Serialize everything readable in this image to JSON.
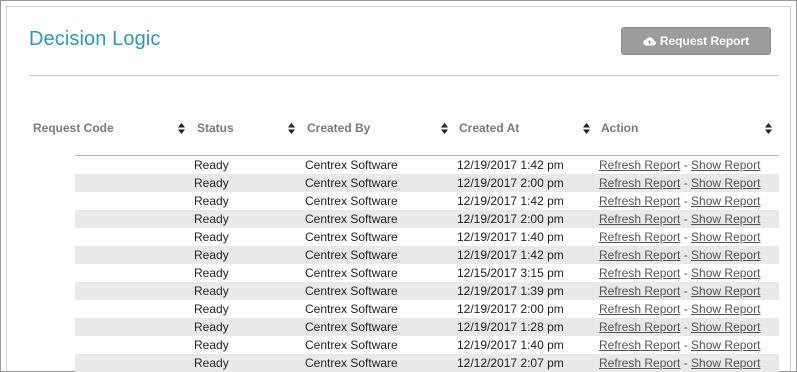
{
  "page": {
    "title": "Decision Logic",
    "request_button_label": "Request Report",
    "request_button_icon": "cloud-upload-icon"
  },
  "table": {
    "columns": [
      "Request Code",
      "Status",
      "Created By",
      "Created At",
      "Action"
    ],
    "rows": [
      {
        "status": "Ready",
        "created_by": "Centrex Software",
        "created_at": "12/19/2017 1:42 pm",
        "refresh": "Refresh Report",
        "sep": " - ",
        "show": "Show Report"
      },
      {
        "status": "Ready",
        "created_by": "Centrex Software",
        "created_at": "12/19/2017 2:00 pm",
        "refresh": "Refresh Report",
        "sep": " - ",
        "show": "Show Report"
      },
      {
        "status": "Ready",
        "created_by": "Centrex Software",
        "created_at": "12/19/2017 1:42 pm",
        "refresh": "Refresh Report",
        "sep": " - ",
        "show": "Show Report"
      },
      {
        "status": "Ready",
        "created_by": "Centrex Software",
        "created_at": "12/19/2017 2:00 pm",
        "refresh": "Refresh Report",
        "sep": " - ",
        "show": "Show Report"
      },
      {
        "status": "Ready",
        "created_by": "Centrex Software",
        "created_at": "12/19/2017 1:40 pm",
        "refresh": "Refresh Report",
        "sep": " - ",
        "show": "Show Report"
      },
      {
        "status": "Ready",
        "created_by": "Centrex Software",
        "created_at": "12/19/2017 1:42 pm",
        "refresh": "Refresh Report",
        "sep": " - ",
        "show": "Show Report"
      },
      {
        "status": "Ready",
        "created_by": "Centrex Software",
        "created_at": "12/15/2017 3:15 pm",
        "refresh": "Refresh Report",
        "sep": " - ",
        "show": "Show Report"
      },
      {
        "status": "Ready",
        "created_by": "Centrex Software",
        "created_at": "12/19/2017 1:39 pm",
        "refresh": "Refresh Report",
        "sep": " - ",
        "show": "Show Report"
      },
      {
        "status": "Ready",
        "created_by": "Centrex Software",
        "created_at": "12/19/2017 2:00 pm",
        "refresh": "Refresh Report",
        "sep": " - ",
        "show": "Show Report"
      },
      {
        "status": "Ready",
        "created_by": "Centrex Software",
        "created_at": "12/19/2017 1:28 pm",
        "refresh": "Refresh Report",
        "sep": " - ",
        "show": "Show Report"
      },
      {
        "status": "Ready",
        "created_by": "Centrex Software",
        "created_at": "12/19/2017 1:40 pm",
        "refresh": "Refresh Report",
        "sep": " - ",
        "show": "Show Report"
      },
      {
        "status": "Ready",
        "created_by": "Centrex Software",
        "created_at": "12/12/2017 2:07 pm",
        "refresh": "Refresh Report",
        "sep": " - ",
        "show": "Show Report"
      }
    ]
  },
  "colors": {
    "title": "#2a9bb1",
    "button_bg": "#9c9c9c",
    "alt_row": "#e9e9e9"
  }
}
